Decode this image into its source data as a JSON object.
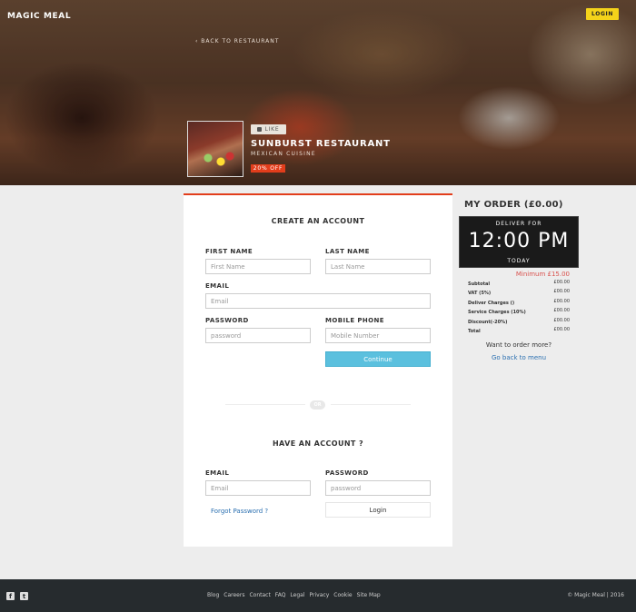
{
  "header": {
    "brand": "MAGIC MEAL",
    "login_label": "LOGIN",
    "back_link": "‹ BACK TO RESTAURANT"
  },
  "restaurant": {
    "like_label": "LIKE",
    "name": "SUNBURST RESTAURANT",
    "cuisine": "MEXICAN CUISINE",
    "discount": "20% OFF"
  },
  "signup": {
    "title": "CREATE AN ACCOUNT",
    "first_name": {
      "label": "FIRST NAME",
      "placeholder": "First Name"
    },
    "last_name": {
      "label": "LAST NAME",
      "placeholder": "Last Name"
    },
    "email": {
      "label": "EMAIL",
      "placeholder": "Email"
    },
    "password": {
      "label": "PASSWORD",
      "placeholder": "password"
    },
    "mobile": {
      "label": "MOBILE PHONE",
      "placeholder": "Mobile Number"
    },
    "continue_label": "Continue"
  },
  "divider": {
    "or_label": "OR"
  },
  "login": {
    "title": "HAVE AN ACCOUNT ?",
    "email": {
      "label": "EMAIL",
      "placeholder": "Email"
    },
    "password": {
      "label": "PASSWORD",
      "placeholder": "password"
    },
    "forgot_label": "Forgot Password ?",
    "login_label": "Login"
  },
  "order": {
    "title": "MY ORDER (£0.00)",
    "deliver_for": "DELIVER FOR",
    "time": "12:00 PM",
    "day": "TODAY",
    "minimum": "Minimum £15.00",
    "rows": [
      {
        "label": "Subtotal",
        "value": "£00.00"
      },
      {
        "label": "VAT (5%)",
        "value": "£00.00"
      },
      {
        "label": "Deliver Charges ()",
        "value": "£00.00"
      },
      {
        "label": "Service Charges (10%)",
        "value": "£00.00"
      },
      {
        "label": "Discount(-20%)",
        "value": "£00.00"
      },
      {
        "label": "Total",
        "value": "£00.00"
      }
    ],
    "want_more": "Want to order more?",
    "go_back": "Go back to menu"
  },
  "footer": {
    "social": [
      {
        "icon": "facebook-icon",
        "glyph": "f"
      },
      {
        "icon": "twitter-icon",
        "glyph": "t"
      }
    ],
    "links": [
      "Blog",
      "Careers",
      "Contact",
      "FAQ",
      "Legal",
      "Privacy",
      "Cookie",
      "Site Map"
    ],
    "copyright": "© Magic Meal | 2016"
  },
  "colors": {
    "accent_red": "#e23d1b",
    "login_yellow": "#f4d31a",
    "continue_blue": "#5bc0de",
    "link_blue": "#2a6fb0",
    "footer_bg": "#262b2e"
  }
}
